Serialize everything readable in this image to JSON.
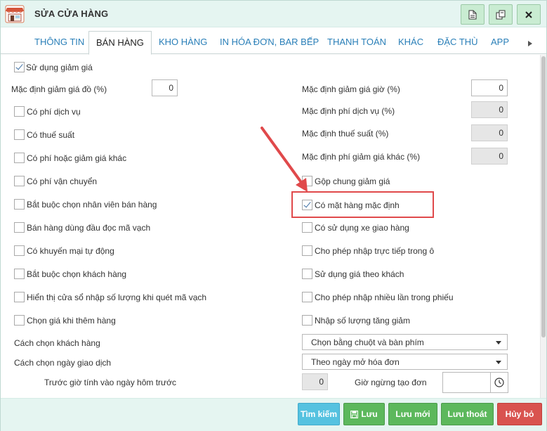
{
  "window": {
    "title": "SỬA CỬA HÀNG"
  },
  "tabs": [
    {
      "label": "THÔNG TIN"
    },
    {
      "label": "BÁN HÀNG"
    },
    {
      "label": "KHO HÀNG"
    },
    {
      "label": "IN HÓA ĐƠN, BAR BẾP"
    },
    {
      "label": "THANH TOÁN"
    },
    {
      "label": "KHÁC"
    },
    {
      "label": "ĐẶC THÙ"
    },
    {
      "label": "APP"
    }
  ],
  "left": {
    "use_discount": {
      "label": "Sử dụng giảm giá",
      "checked": true
    },
    "default_discount_food": {
      "label": "Mặc định giảm giá đồ (%)",
      "value": "0"
    },
    "options": [
      {
        "label": "Có phí dịch vụ",
        "checked": false
      },
      {
        "label": "Có thuế suất",
        "checked": false
      },
      {
        "label": "Có phí hoặc giảm giá khác",
        "checked": false
      },
      {
        "label": "Có phí vận chuyển",
        "checked": false
      },
      {
        "label": "Bắt buộc chọn nhân viên bán hàng",
        "checked": false
      },
      {
        "label": "Bán hàng dùng đầu đọc mã vạch",
        "checked": false
      },
      {
        "label": "Có khuyến mại tự động",
        "checked": false
      },
      {
        "label": "Bắt buộc chọn khách hàng",
        "checked": false
      },
      {
        "label": "Hiển thị cửa sổ nhập số lượng khi quét mã vạch",
        "checked": false
      },
      {
        "label": "Chọn giá khi thêm hàng",
        "checked": false
      }
    ]
  },
  "right": {
    "defaults": [
      {
        "label": "Mặc định giảm giá giờ (%)",
        "value": "0",
        "disabled": false
      },
      {
        "label": "Mặc định phí dịch vụ (%)",
        "value": "0",
        "disabled": true
      },
      {
        "label": "Mặc định thuế suất (%)",
        "value": "0",
        "disabled": true
      },
      {
        "label": "Mặc định phí giảm giá khác (%)",
        "value": "0",
        "disabled": true
      }
    ],
    "options": [
      {
        "label": "Gộp chung giảm giá",
        "checked": false
      },
      {
        "label": "Có mặt hàng mặc định",
        "checked": true
      },
      {
        "label": "Có sử dụng xe giao hàng",
        "checked": false
      },
      {
        "label": "Cho phép nhập trực tiếp trong ô",
        "checked": false
      },
      {
        "label": "Sử dụng giá theo khách",
        "checked": false
      },
      {
        "label": "Cho phép nhập nhiều lần trong phiếu",
        "checked": false
      },
      {
        "label": "Nhập số lượng tăng giảm",
        "checked": false
      }
    ]
  },
  "customer_select": {
    "label": "Cách chọn khách hàng",
    "value": "Chọn bằng chuột và bàn phím"
  },
  "date_select": {
    "label": "Cách chọn ngày giao dịch",
    "value": "Theo ngày mở hóa đơn"
  },
  "hours_before": {
    "label": "Trước giờ tính vào ngày hôm trước",
    "value": "0"
  },
  "stop_time": {
    "label": "Giờ ngừng tạo đơn",
    "value": ""
  },
  "footer": {
    "search": "Tìm kiếm",
    "save": "Lưu",
    "save_new": "Lưu mới",
    "save_exit": "Lưu thoát",
    "cancel": "Hủy bỏ"
  },
  "colors": {
    "accent": "#2a7fb8",
    "header_bg": "#e5f5f1",
    "save_green": "#5cb85c",
    "search_blue": "#55c2e0",
    "cancel_red": "#d9534f",
    "highlight_red": "#e0494b"
  },
  "icons": {
    "app": "store-icon",
    "toolbar": [
      "document-icon",
      "copy-icon",
      "close-icon"
    ],
    "save": "floppy-disk-icon",
    "time": "clock-icon",
    "tab_scroll": "triangle-right-icon"
  }
}
